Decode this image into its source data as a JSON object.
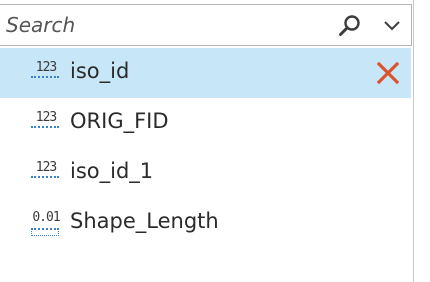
{
  "search": {
    "placeholder": "Search",
    "value": ""
  },
  "icons": {
    "search": "search-icon",
    "dropdown": "chevron-down-icon",
    "remove": "close-icon",
    "integer_type": "integer-field-type-icon",
    "decimal_type": "decimal-field-type-icon"
  },
  "colors": {
    "selected_row": "#c7e6f8",
    "remove_icon": "#d9532c",
    "type_icon_accent": "#3a83c8"
  },
  "fields": [
    {
      "name": "iso_id",
      "type_glyph": "123",
      "selected": true
    },
    {
      "name": "ORIG_FID",
      "type_glyph": "123",
      "selected": false
    },
    {
      "name": "iso_id_1",
      "type_glyph": "123",
      "selected": false
    },
    {
      "name": "Shape_Length",
      "type_glyph": "0.01",
      "selected": false
    }
  ]
}
